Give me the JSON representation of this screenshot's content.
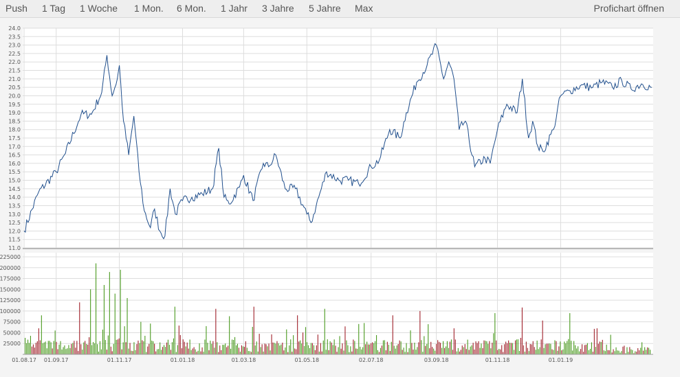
{
  "toolbar": {
    "tabs": [
      "Push",
      "1 Tag",
      "1 Woche",
      "1 Mon.",
      "6 Mon.",
      "1 Jahr",
      "3 Jahre",
      "5 Jahre",
      "Max"
    ],
    "profichart_label": "Profichart öffnen"
  },
  "colors": {
    "price_line": "#1f4e8c",
    "volume_up": "#4a9a1f",
    "volume_down": "#a0202a",
    "grid": "#dddddd",
    "panel_bg": "#ffffff",
    "frame_bg": "#f4f4f4"
  },
  "chart_data": [
    {
      "type": "line",
      "title": "",
      "xlabel": "",
      "ylabel": "",
      "ylim": [
        11.0,
        24.0
      ],
      "yticks": [
        "11.0",
        "11.5",
        "12.0",
        "12.5",
        "13.0",
        "13.5",
        "14.0",
        "14.5",
        "15.0",
        "15.5",
        "16.0",
        "16.5",
        "17.0",
        "17.5",
        "18.0",
        "18.5",
        "19.0",
        "19.5",
        "20.0",
        "20.5",
        "21.0",
        "21.5",
        "22.0",
        "22.5",
        "23.0",
        "23.5",
        "24.0"
      ],
      "grid": true,
      "x": [
        "2017-08-01",
        "2017-08-15",
        "2017-09-01",
        "2017-09-10",
        "2017-09-25",
        "2017-10-05",
        "2017-10-15",
        "2017-10-20",
        "2017-10-25",
        "2017-10-30",
        "2017-11-01",
        "2017-11-05",
        "2017-11-10",
        "2017-11-15",
        "2017-11-20",
        "2017-11-25",
        "2017-12-01",
        "2017-12-05",
        "2017-12-10",
        "2017-12-15",
        "2017-12-20",
        "2017-12-25",
        "2018-01-01",
        "2018-01-10",
        "2018-01-20",
        "2018-01-30",
        "2018-02-05",
        "2018-02-10",
        "2018-02-15",
        "2018-02-25",
        "2018-03-01",
        "2018-03-10",
        "2018-03-20",
        "2018-03-25",
        "2018-04-01",
        "2018-04-10",
        "2018-04-20",
        "2018-05-01",
        "2018-05-05",
        "2018-05-10",
        "2018-05-20",
        "2018-06-01",
        "2018-06-10",
        "2018-06-20",
        "2018-07-02",
        "2018-07-10",
        "2018-07-20",
        "2018-07-30",
        "2018-08-05",
        "2018-08-15",
        "2018-08-25",
        "2018-09-03",
        "2018-09-10",
        "2018-09-15",
        "2018-09-20",
        "2018-09-25",
        "2018-10-01",
        "2018-10-10",
        "2018-10-20",
        "2018-10-25",
        "2018-11-01",
        "2018-11-10",
        "2018-11-20",
        "2018-11-25",
        "2018-12-01",
        "2018-12-05",
        "2018-12-10",
        "2018-12-15",
        "2018-12-25",
        "2019-01-01",
        "2019-01-10",
        "2019-01-20",
        "2019-02-01",
        "2019-02-10",
        "2019-02-20",
        "2019-03-01",
        "2019-03-10",
        "2019-03-20",
        "2019-03-30"
      ],
      "series": [
        {
          "values": [
            12.0,
            14.3,
            15.5,
            16.6,
            18.9,
            18.9,
            20.2,
            22.4,
            20.0,
            21.0,
            21.8,
            18.5,
            16.5,
            18.8,
            15.5,
            13.2,
            12.2,
            13.3,
            12.0,
            11.7,
            14.5,
            13.0,
            13.8,
            14.0,
            14.2,
            14.5,
            16.9,
            14.0,
            13.6,
            14.6,
            15.3,
            13.8,
            16.0,
            15.8,
            16.5,
            14.5,
            14.5,
            13.0,
            12.5,
            13.5,
            15.5,
            15.0,
            15.0,
            14.8,
            15.8,
            16.2,
            18.0,
            17.5,
            19.0,
            20.8,
            21.8,
            23.0,
            21.0,
            22.0,
            21.0,
            18.0,
            18.5,
            15.8,
            16.3,
            16.0,
            18.0,
            19.5,
            19.0,
            21.0,
            17.5,
            18.5,
            17.0,
            16.7,
            18.0,
            20.0,
            20.3,
            20.6,
            20.5,
            20.8,
            20.5,
            20.9,
            20.4,
            20.7,
            20.5
          ]
        }
      ]
    },
    {
      "type": "bar",
      "title": "",
      "xlabel": "",
      "ylabel": "",
      "ylim": [
        0,
        225000
      ],
      "yticks": [
        "25000",
        "50000",
        "75000",
        "100000",
        "125000",
        "150000",
        "175000",
        "200000",
        "225000"
      ],
      "grid": true,
      "x_tick_labels": [
        "01.08.17",
        "01.09.17",
        "01.11.17",
        "01.01.18",
        "01.03.18",
        "01.05.18",
        "02.07.18",
        "03.09.18",
        "01.11.18",
        "01.01.19"
      ],
      "series": [
        {
          "name": "",
          "values": []
        }
      ]
    }
  ]
}
